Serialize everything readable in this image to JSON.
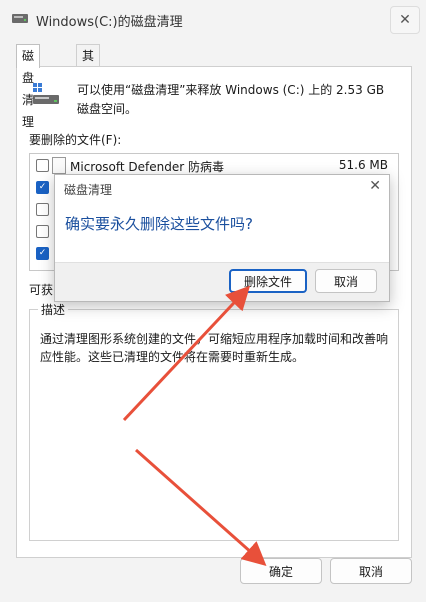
{
  "window": {
    "title": "Windows(C:)的磁盘清理",
    "close_glyph": "✕"
  },
  "tabs": [
    "磁盘清理",
    "其他选项"
  ],
  "intro": "可以使用“磁盘清理”来释放 Windows (C:) 上的 2.53 GB 磁盘空间。",
  "files_label": "要删除的文件(F):",
  "files": [
    {
      "checked": false,
      "name": "Microsoft Defender 防病毒",
      "size": "51.6 MB"
    },
    {
      "checked": true,
      "name": "",
      "size": ""
    },
    {
      "checked": false,
      "name": "",
      "size": ""
    },
    {
      "checked": false,
      "name": "",
      "size": ""
    },
    {
      "checked": true,
      "name": "",
      "size": ""
    }
  ],
  "obtain_label": "可获",
  "description": {
    "legend": "描述",
    "text": "通过清理图形系统创建的文件，可缩短应用程序加载时间和改善响应性能。这些已清理的文件将在需要时重新生成。"
  },
  "buttons": {
    "ok": "确定",
    "cancel": "取消"
  },
  "dialog": {
    "title": "磁盘清理",
    "close_glyph": "✕",
    "message": "确实要永久删除这些文件吗?",
    "delete_label": "删除文件",
    "cancel_label": "取消"
  },
  "colors": {
    "accent": "#1a62c4",
    "arrow": "#e8503a"
  }
}
